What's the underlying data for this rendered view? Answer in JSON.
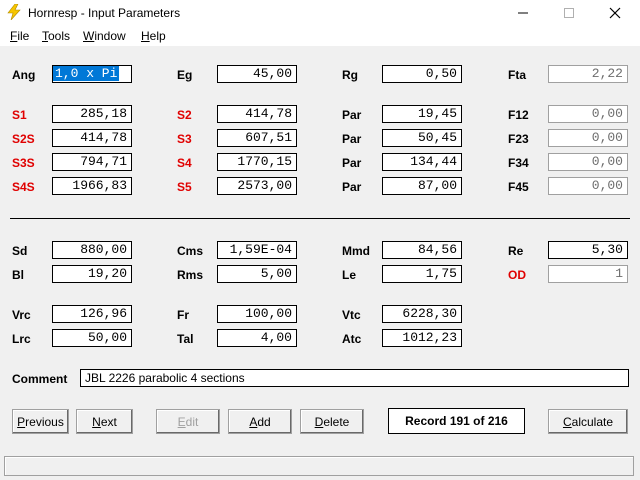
{
  "window": {
    "title": "Hornresp - Input Parameters",
    "icon": "lightning-icon",
    "controls": [
      "minimize-icon",
      "maximize-icon",
      "close-icon"
    ]
  },
  "menu": [
    {
      "u": "F",
      "rest": "ile"
    },
    {
      "u": "T",
      "rest": "ools"
    },
    {
      "u": "W",
      "rest": "indow"
    },
    {
      "u": "H",
      "rest": "elp"
    }
  ],
  "params": {
    "ang": {
      "label": "Ang",
      "value": "1,0 x Pi"
    },
    "eg": {
      "label": "Eg",
      "value": "45,00"
    },
    "rg": {
      "label": "Rg",
      "value": "0,50"
    },
    "fta": {
      "label": "Fta",
      "value": "2,22"
    },
    "s1": {
      "label": "S1",
      "value": "285,18"
    },
    "s2": {
      "label": "S2",
      "value": "414,78"
    },
    "par1": {
      "label": "Par",
      "value": "19,45"
    },
    "f12": {
      "label": "F12",
      "value": "0,00"
    },
    "s2s": {
      "label": "S2S",
      "value": "414,78"
    },
    "s3": {
      "label": "S3",
      "value": "607,51"
    },
    "par2": {
      "label": "Par",
      "value": "50,45"
    },
    "f23": {
      "label": "F23",
      "value": "0,00"
    },
    "s3s": {
      "label": "S3S",
      "value": "794,71"
    },
    "s4": {
      "label": "S4",
      "value": "1770,15"
    },
    "par3": {
      "label": "Par",
      "value": "134,44"
    },
    "f34": {
      "label": "F34",
      "value": "0,00"
    },
    "s4s": {
      "label": "S4S",
      "value": "1966,83"
    },
    "s5": {
      "label": "S5",
      "value": "2573,00"
    },
    "par4": {
      "label": "Par",
      "value": "87,00"
    },
    "f45": {
      "label": "F45",
      "value": "0,00"
    },
    "sd": {
      "label": "Sd",
      "value": "880,00"
    },
    "cms": {
      "label": "Cms",
      "value": "1,59E-04"
    },
    "mmd": {
      "label": "Mmd",
      "value": "84,56"
    },
    "re": {
      "label": "Re",
      "value": "5,30"
    },
    "bl": {
      "label": "Bl",
      "value": "19,20"
    },
    "rms": {
      "label": "Rms",
      "value": "5,00"
    },
    "le": {
      "label": "Le",
      "value": "1,75"
    },
    "od": {
      "label": "OD",
      "value": "1"
    },
    "vrc": {
      "label": "Vrc",
      "value": "126,96"
    },
    "fr": {
      "label": "Fr",
      "value": "100,00"
    },
    "vtc": {
      "label": "Vtc",
      "value": "6228,30"
    },
    "lrc": {
      "label": "Lrc",
      "value": "50,00"
    },
    "tal": {
      "label": "Tal",
      "value": "4,00"
    },
    "atc": {
      "label": "Atc",
      "value": "1012,23"
    }
  },
  "comment": {
    "label": "Comment",
    "value": "JBL 2226 parabolic 4 sections"
  },
  "buttons": {
    "previous": {
      "u": "P",
      "rest": "revious"
    },
    "next": {
      "u": "N",
      "rest": "ext"
    },
    "edit": {
      "u": "E",
      "rest": "dit"
    },
    "add": {
      "u": "A",
      "rest": "dd"
    },
    "delete": {
      "u": "D",
      "rest": "elete"
    },
    "calculate": {
      "u": "C",
      "rest": "alculate"
    }
  },
  "record": "Record 191 of 216",
  "colors": {
    "red_label": "#e00000",
    "selection": "#0078d7"
  }
}
